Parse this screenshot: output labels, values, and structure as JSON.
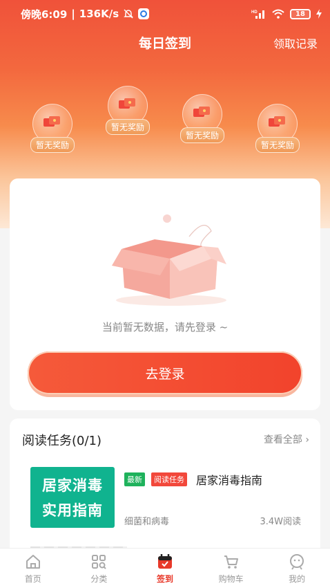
{
  "status_bar": {
    "time": "傍晚6:09",
    "speed": "136K/s",
    "battery": "18"
  },
  "header": {
    "title": "每日签到",
    "records_link": "领取记录"
  },
  "rewards": [
    {
      "label": "暂无奖励"
    },
    {
      "label": "暂无奖励"
    },
    {
      "label": "暂无奖励"
    },
    {
      "label": "暂无奖励"
    }
  ],
  "empty_state": {
    "message": "当前暂无数据，请先登录 ~",
    "login_button": "去登录"
  },
  "reading_tasks": {
    "title": "阅读任务(0/1)",
    "view_all": "查看全部",
    "article": {
      "thumb_line1": "居家消毒",
      "thumb_line2": "实用指南",
      "tag_new": "最新",
      "tag_task": "阅读任务",
      "title": "居家消毒指南",
      "category": "细菌和病毒",
      "reads": "3.4W阅读"
    }
  },
  "tabbar": {
    "items": [
      {
        "label": "首页",
        "icon": "home-icon"
      },
      {
        "label": "分类",
        "icon": "grid-icon"
      },
      {
        "label": "签到",
        "icon": "calendar-icon",
        "active": true
      },
      {
        "label": "购物车",
        "icon": "cart-icon"
      },
      {
        "label": "我的",
        "icon": "profile-icon"
      }
    ]
  },
  "colors": {
    "accent": "#e8392a",
    "green_thumb": "#10b38f"
  }
}
